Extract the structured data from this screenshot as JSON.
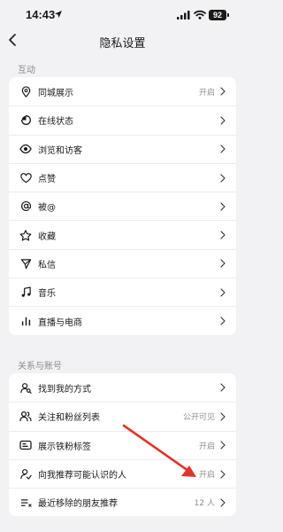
{
  "status_bar": {
    "time": "14:43",
    "battery": "92"
  },
  "header": {
    "title": "隐私设置"
  },
  "sections": [
    {
      "label": "互动",
      "items": [
        {
          "icon": "location-pin-icon",
          "label": "同城展示",
          "value": "开启"
        },
        {
          "icon": "online-status-icon",
          "label": "在线状态",
          "value": ""
        },
        {
          "icon": "eye-icon",
          "label": "浏览和访客",
          "value": ""
        },
        {
          "icon": "heart-icon",
          "label": "点赞",
          "value": ""
        },
        {
          "icon": "at-sign-icon",
          "label": "被@",
          "value": ""
        },
        {
          "icon": "star-icon",
          "label": "收藏",
          "value": ""
        },
        {
          "icon": "send-icon",
          "label": "私信",
          "value": ""
        },
        {
          "icon": "music-note-icon",
          "label": "音乐",
          "value": ""
        },
        {
          "icon": "bar-chart-icon",
          "label": "直播与电商",
          "value": ""
        }
      ]
    },
    {
      "label": "关系与账号",
      "items": [
        {
          "icon": "user-search-icon",
          "label": "找到我的方式",
          "value": ""
        },
        {
          "icon": "users-icon",
          "label": "关注和粉丝列表",
          "value": "公开可见"
        },
        {
          "icon": "badge-icon",
          "label": "展示铁粉标签",
          "value": "开启"
        },
        {
          "icon": "user-recommend-icon",
          "label": "向我推荐可能认识的人",
          "value": "开启"
        },
        {
          "icon": "list-icon",
          "label": "最近移除的朋友推荐",
          "value": "12 人"
        }
      ]
    }
  ],
  "colors": {
    "annotation_arrow": "#e0352b"
  }
}
